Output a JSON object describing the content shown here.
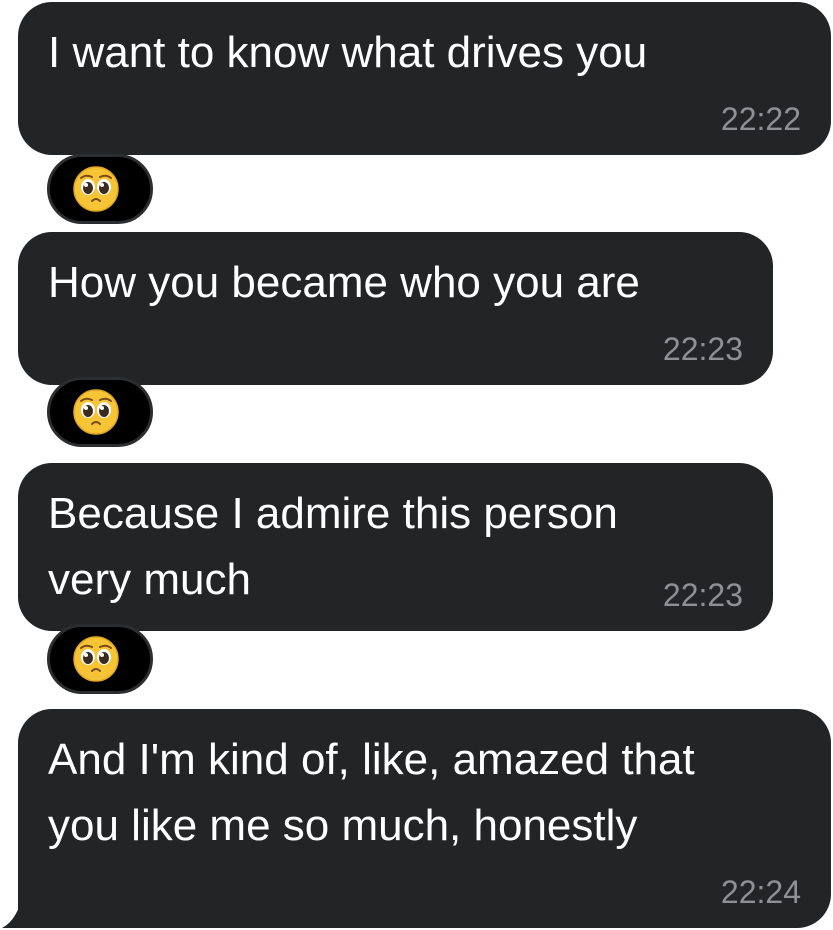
{
  "messages": [
    {
      "text": "I want to know what drives you",
      "time": "22:22",
      "reaction": "pleading-face-emoji"
    },
    {
      "text": "How you became who you are",
      "time": "22:23",
      "reaction": "pleading-face-emoji"
    },
    {
      "text": "Because I admire this person\nvery much",
      "time": "22:23",
      "reaction": "pleading-face-emoji"
    },
    {
      "text": "And I'm kind of, like, amazed that\nyou like me so much, honestly",
      "time": "22:24"
    }
  ],
  "colors": {
    "bubble": "#222426",
    "text": "#ffffff",
    "time": "#8e9193",
    "reaction_pill": "#000000",
    "emoji_face": "#f7c436"
  }
}
